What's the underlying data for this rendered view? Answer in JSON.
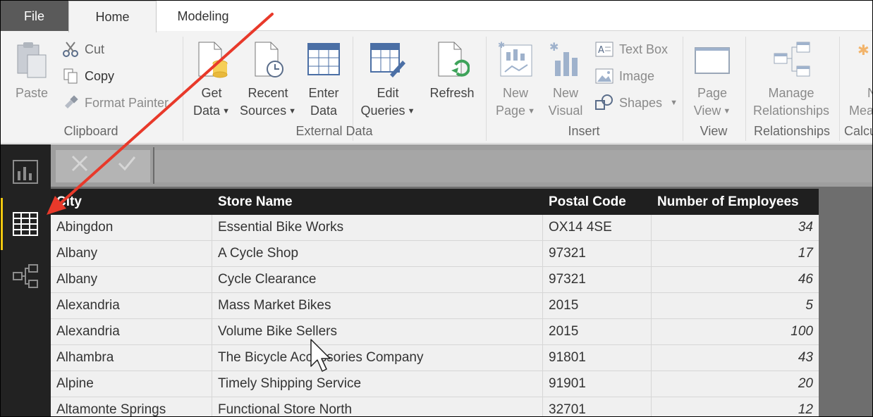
{
  "tabs": {
    "file": "File",
    "home": "Home",
    "modeling": "Modeling"
  },
  "clipboard": {
    "paste": "Paste",
    "cut": "Cut",
    "copy": "Copy",
    "format_painter": "Format Painter",
    "group": "Clipboard"
  },
  "external_data": {
    "get_data": [
      "Get",
      "Data"
    ],
    "recent_sources": [
      "Recent",
      "Sources"
    ],
    "enter_data": [
      "Enter",
      "Data"
    ],
    "edit_queries": [
      "Edit",
      "Queries"
    ],
    "refresh": "Refresh",
    "group": "External Data"
  },
  "insert": {
    "new_page": [
      "New",
      "Page"
    ],
    "new_visual": [
      "New",
      "Visual"
    ],
    "text_box": "Text Box",
    "image": "Image",
    "shapes": "Shapes",
    "group": "Insert"
  },
  "view": {
    "page_view": [
      "Page",
      "View"
    ],
    "group": "View"
  },
  "relationships": {
    "manage": [
      "Manage",
      "Relationships"
    ],
    "group": "Relationships"
  },
  "calculations": {
    "new_measure": [
      "N",
      "Mea"
    ],
    "group": "Calcu"
  },
  "table": {
    "headers": [
      "City",
      "Store Name",
      "Postal Code",
      "Number of Employees"
    ],
    "rows": [
      [
        "Abingdon",
        "Essential Bike Works",
        "OX14 4SE",
        "34"
      ],
      [
        "Albany",
        "A Cycle Shop",
        "97321",
        "17"
      ],
      [
        "Albany",
        "Cycle Clearance",
        "97321",
        "46"
      ],
      [
        "Alexandria",
        "Mass Market Bikes",
        "2015",
        "5"
      ],
      [
        "Alexandria",
        "Volume Bike Sellers",
        "2015",
        "100"
      ],
      [
        "Alhambra",
        "The Bicycle Accessories Company",
        "91801",
        "43"
      ],
      [
        "Alpine",
        "Timely Shipping Service",
        "91901",
        "20"
      ],
      [
        "Altamonte Springs",
        "Functional Store North",
        "32701",
        "12"
      ]
    ]
  },
  "colors": {
    "accent": "#f2c80f",
    "sidebar": "#222222",
    "annotation_arrow": "#e8392a"
  }
}
